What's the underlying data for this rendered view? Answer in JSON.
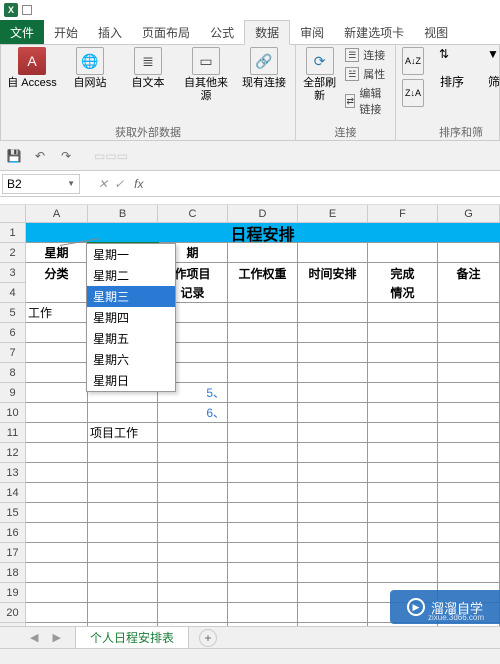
{
  "tabs": {
    "file": "文件",
    "home": "开始",
    "insert": "插入",
    "pagelayout": "页面布局",
    "formulas": "公式",
    "data": "数据",
    "review": "审阅",
    "newtab": "新建选项卡",
    "view": "视图"
  },
  "ribbon": {
    "group1_label": "获取外部数据",
    "access": "自 Access",
    "web": "自网站",
    "text": "自文本",
    "other": "自其他来源",
    "exist": "现有连接",
    "refresh": "全部刷新",
    "conn_label": "连接",
    "conn": "连接",
    "prop": "属性",
    "editlink": "编辑链接",
    "sort_asc": "A↓Z",
    "sort_desc": "Z↓A",
    "sort": "排序",
    "filter": "筛选",
    "sortfilter_label": "排序和筛"
  },
  "namebox": "B2",
  "sheet": {
    "row1_title": "日程安排",
    "a2": "星期",
    "c2": "期",
    "a34": "分类",
    "c3a": "作项目",
    "c3b": "记录",
    "d34": "工作权重",
    "e34": "时间安排",
    "f3": "完成",
    "f4": "情况",
    "g34": "备注",
    "a5": "工作",
    "c9": "5、",
    "c10": "6、",
    "b11": "项目工作"
  },
  "dropdown": {
    "items": [
      "星期一",
      "星期二",
      "星期三",
      "星期四",
      "星期五",
      "星期六",
      "星期日"
    ],
    "selected": "星期三"
  },
  "sheettab": "个人日程安排表",
  "columns": [
    "A",
    "B",
    "C",
    "D",
    "E",
    "F",
    "G"
  ],
  "watermark": {
    "main": "溜溜自学",
    "sub": "zixue.3d66.com"
  }
}
